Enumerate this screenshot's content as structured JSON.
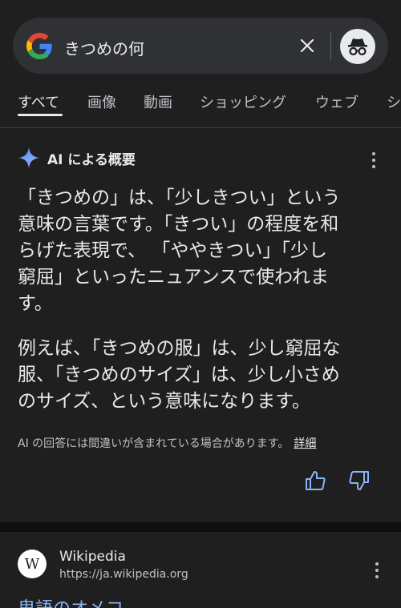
{
  "search": {
    "query": "きつめの何"
  },
  "tabs": [
    "すべて",
    "画像",
    "動画",
    "ショッピング",
    "ウェブ",
    "シ"
  ],
  "ai_overview": {
    "title": "AI による概要",
    "paragraph1_lines": [
      "「きつめの」は、「少しきつい」という",
      "意味の言葉です。「きつい」の程度を和",
      "らげた表現で、 「ややきつい」「少し",
      "窮屈」といったニュアンスで使われま",
      "す。"
    ],
    "paragraph2_lines": [
      "例えば、「きつめの服」は、少し窮屈な",
      "服、「きつめのサイズ」は、少し小さめ",
      "のサイズ、という意味になります。"
    ],
    "disclaimer": "AI の回答には間違いが含まれている場合があります。",
    "details_link": "詳細"
  },
  "result": {
    "favicon_letter": "W",
    "site_name": "Wikipedia",
    "url": "https://ja.wikipedia.org",
    "title": "卑語のオメコ"
  },
  "colors": {
    "background": "#1f1f1f",
    "search_bg": "#303134",
    "link_blue": "#8ab4f8",
    "ai_spark": "#8ab4f8"
  }
}
